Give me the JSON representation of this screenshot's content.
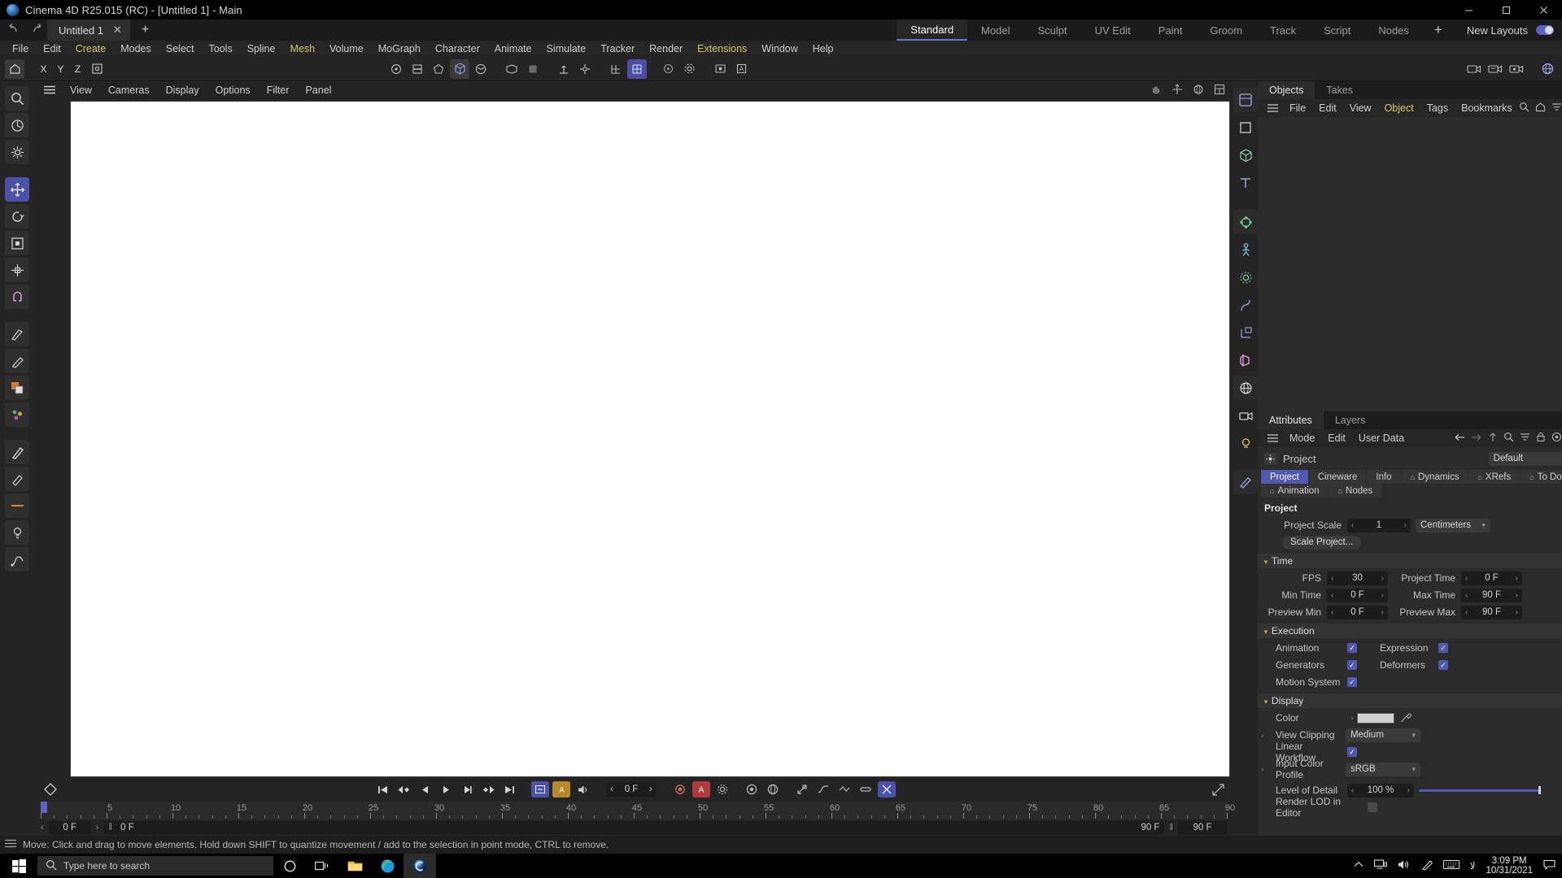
{
  "window": {
    "title": "Cinema 4D R25.015 (RC) - [Untitled 1] - Main",
    "app_icon": "cinema4d-logo-icon",
    "minimize": "–",
    "maximize": "❐",
    "close": "✕"
  },
  "tabrow": {
    "undo_icon": "undo-icon",
    "redo_icon": "redo-icon",
    "doc_tab": "Untitled 1",
    "doc_close": "✕",
    "new_tab": "+",
    "layouts": [
      {
        "label": "Standard",
        "active": true
      },
      {
        "label": "Model",
        "active": false
      },
      {
        "label": "Sculpt",
        "active": false
      },
      {
        "label": "UV Edit",
        "active": false
      },
      {
        "label": "Paint",
        "active": false
      },
      {
        "label": "Groom",
        "active": false
      },
      {
        "label": "Track",
        "active": false
      },
      {
        "label": "Script",
        "active": false
      },
      {
        "label": "Nodes",
        "active": false
      }
    ],
    "layout_add": "+",
    "new_layouts_label": "New Layouts"
  },
  "menubar": [
    {
      "label": "File",
      "highlight": false
    },
    {
      "label": "Edit",
      "highlight": false
    },
    {
      "label": "Create",
      "highlight": true
    },
    {
      "label": "Modes",
      "highlight": false
    },
    {
      "label": "Select",
      "highlight": false
    },
    {
      "label": "Tools",
      "highlight": false
    },
    {
      "label": "Spline",
      "highlight": false
    },
    {
      "label": "Mesh",
      "highlight": true
    },
    {
      "label": "Volume",
      "highlight": false
    },
    {
      "label": "MoGraph",
      "highlight": false
    },
    {
      "label": "Character",
      "highlight": false
    },
    {
      "label": "Animate",
      "highlight": false
    },
    {
      "label": "Simulate",
      "highlight": false
    },
    {
      "label": "Tracker",
      "highlight": false
    },
    {
      "label": "Render",
      "highlight": false
    },
    {
      "label": "Extensions",
      "highlight": true
    },
    {
      "label": "Window",
      "highlight": false
    },
    {
      "label": "Help",
      "highlight": false
    }
  ],
  "toolbar": {
    "left": [
      {
        "name": "home-layout-icon",
        "state": "sel"
      },
      {
        "name": "axis-x-icon",
        "state": "normal",
        "text": "X"
      },
      {
        "name": "axis-y-icon",
        "state": "normal",
        "text": "Y"
      },
      {
        "name": "axis-z-icon",
        "state": "normal",
        "text": "Z"
      },
      {
        "name": "world-object-coord-icon",
        "state": "normal"
      }
    ],
    "center": [
      {
        "name": "point-mode-icon",
        "state": "normal"
      },
      {
        "name": "edge-mode-icon",
        "state": "normal"
      },
      {
        "name": "polygon-mode-icon",
        "state": "normal"
      },
      {
        "name": "model-mode-icon",
        "state": "sel"
      },
      {
        "name": "texture-mode-icon",
        "state": "normal"
      },
      {
        "name": "workplane-icon",
        "state": "normal"
      },
      {
        "name": "viewport-solo-icon",
        "state": "normal"
      },
      {
        "name": "enable-axis-icon",
        "state": "normal"
      },
      {
        "name": "axis-lock-icon",
        "state": "normal"
      },
      {
        "name": "snap-icon",
        "state": "normal"
      },
      {
        "name": "quantize-icon",
        "state": "on"
      },
      {
        "name": "workplane-lock-icon",
        "state": "normal"
      },
      {
        "name": "render-view-icon",
        "state": "normal"
      },
      {
        "name": "render-region-icon",
        "state": "normal"
      },
      {
        "name": "render-settings-icon",
        "state": "normal"
      }
    ],
    "right": [
      {
        "name": "render-picture-viewer-icon",
        "state": "normal"
      },
      {
        "name": "render-queue-icon",
        "state": "normal"
      },
      {
        "name": "render-team-icon",
        "state": "normal"
      },
      {
        "name": "content-browser-icon",
        "state": "normal"
      }
    ]
  },
  "lefttools": [
    {
      "name": "magnify-tool-icon",
      "state": "sub"
    },
    {
      "name": "live-selection-tool-icon",
      "state": "sub"
    },
    {
      "name": "tool-settings-icon",
      "state": "sub"
    },
    {
      "name": "move-tool-icon",
      "state": "active"
    },
    {
      "name": "rotate-tool-icon",
      "state": "sub"
    },
    {
      "name": "scale-tool-icon",
      "state": "sub"
    },
    {
      "name": "transform-tool-icon",
      "state": "sub"
    },
    {
      "name": "magnet-tool-icon",
      "state": "sub"
    },
    {
      "name": "knife-tool-icon",
      "state": "sub"
    },
    {
      "name": "paint-tool-icon",
      "state": "sub"
    },
    {
      "name": "color-swatch-icon",
      "state": "sub"
    },
    {
      "name": "sculpt-tool-icon",
      "state": "sub"
    },
    {
      "name": "brush-tool-icon",
      "state": "sub"
    },
    {
      "name": "eraser-tool-icon",
      "state": "sub"
    },
    {
      "name": "light-tool-icon",
      "state": "sub"
    },
    {
      "name": "spline-pen-icon",
      "state": "sub"
    }
  ],
  "viewport": {
    "menu": [
      "View",
      "Cameras",
      "Display",
      "Options",
      "Filter",
      "Panel"
    ],
    "hamburger_icon": "hamburger-icon",
    "right_icons": [
      "pan-hand-icon",
      "move-camera-icon",
      "orbit-camera-icon",
      "maximize-view-icon"
    ],
    "background_color": "#fefefe"
  },
  "timeline": {
    "key_icon": "record-keyframe-icon",
    "transport": [
      {
        "name": "go-to-start-icon"
      },
      {
        "name": "step-back-keyframe-icon"
      },
      {
        "name": "step-back-frame-icon"
      },
      {
        "name": "play-forward-icon"
      },
      {
        "name": "step-forward-frame-icon"
      },
      {
        "name": "step-forward-keyframe-icon"
      },
      {
        "name": "go-to-end-icon"
      }
    ],
    "toggles": [
      {
        "name": "autokey-icon",
        "state": "on"
      },
      {
        "name": "keyframe-selection-icon",
        "state": "on"
      },
      {
        "name": "sound-icon",
        "state": "normal"
      }
    ],
    "current_frame": "0 F",
    "record_buttons": [
      {
        "name": "record-active-objects-icon"
      },
      {
        "name": "autokeying-icon"
      },
      {
        "name": "keyframe-settings-icon"
      },
      {
        "name": "position-key-icon"
      },
      {
        "name": "rotation-key-icon"
      },
      {
        "name": "scale-key-icon"
      },
      {
        "name": "param-key-icon"
      },
      {
        "name": "pla-key-icon"
      },
      {
        "name": "point-level-anim-icon"
      },
      {
        "name": "toggle-key-icon"
      },
      {
        "name": "auto-key-toggle-icon"
      }
    ],
    "keyframe-shape-icon": "keyframe-diamond-icon",
    "ruler": {
      "min": 0,
      "max": 90,
      "major_ticks": [
        0,
        5,
        10,
        15,
        20,
        25,
        30,
        35,
        40,
        45,
        50,
        55,
        60,
        65,
        70,
        75,
        80,
        85,
        90
      ],
      "playhead_frame": 0
    },
    "foot": {
      "prev_arrow": "‹",
      "next_arrow": "›",
      "frame_field": "0 F",
      "loop_icon": "‖",
      "loop_field": "0 F",
      "max_right": "90 F",
      "pause_icon": "‖",
      "preview_max": "90 F"
    }
  },
  "objects_panel": {
    "tabs": [
      {
        "label": "Objects",
        "active": true
      },
      {
        "label": "Takes",
        "active": false
      }
    ],
    "hamburger_icon": "hamburger-icon",
    "menu": [
      {
        "label": "File",
        "highlight": false
      },
      {
        "label": "Edit",
        "highlight": false
      },
      {
        "label": "View",
        "highlight": false
      },
      {
        "label": "Object",
        "highlight": true
      },
      {
        "label": "Tags",
        "highlight": false
      },
      {
        "label": "Bookmarks",
        "highlight": false
      }
    ],
    "icons": [
      "search-icon",
      "home-icon",
      "filter-icon",
      "open-external-icon"
    ],
    "items": []
  },
  "right_icons": [
    {
      "name": "layout-manager-icon",
      "boxed": true
    },
    {
      "name": "rectangle-primitive-icon",
      "boxed": false
    },
    {
      "name": "cube-primitive-icon",
      "boxed": false
    },
    {
      "name": "text-tool-icon",
      "boxed": false
    },
    {
      "name": "mograph-cloner-icon",
      "boxed": true
    },
    {
      "name": "character-rig-icon",
      "boxed": false
    },
    {
      "name": "simulate-particles-icon",
      "boxed": false
    },
    {
      "name": "deformer-bend-icon",
      "boxed": false
    },
    {
      "name": "scene-axis-icon",
      "boxed": false
    },
    {
      "name": "field-object-icon",
      "boxed": false
    },
    {
      "name": "environment-sky-icon",
      "boxed": false
    },
    {
      "name": "camera-object-icon",
      "boxed": false
    },
    {
      "name": "light-object-icon",
      "boxed": false
    },
    {
      "name": "material-editor-icon",
      "boxed": false
    }
  ],
  "attributes": {
    "tabs": [
      {
        "label": "Attributes",
        "active": true
      },
      {
        "label": "Layers",
        "active": false
      }
    ],
    "hamburger_icon": "hamburger-icon",
    "menu": [
      {
        "label": "Mode",
        "highlight": false
      },
      {
        "label": "Edit",
        "highlight": false
      },
      {
        "label": "User Data",
        "highlight": false
      }
    ],
    "icons": [
      "back-arrow-icon",
      "forward-arrow-icon",
      "up-arrow-icon",
      "search-icon",
      "filter-icon",
      "lock-icon",
      "target-icon",
      "open-external-icon"
    ],
    "object_icon": "project-settings-icon",
    "object_name": "Project",
    "preset_value": "Default",
    "preset_chevron": "⌄",
    "sheet_tabs": [
      {
        "label": "Project",
        "active": true,
        "lock": false
      },
      {
        "label": "Cineware",
        "active": false,
        "lock": false
      },
      {
        "label": "Info",
        "active": false,
        "lock": false
      },
      {
        "label": "Dynamics",
        "active": false,
        "lock": true
      },
      {
        "label": "XRefs",
        "active": false,
        "lock": true
      },
      {
        "label": "To Do",
        "active": false,
        "lock": true
      },
      {
        "label": "Animation",
        "active": false,
        "lock": true
      },
      {
        "label": "Nodes",
        "active": false,
        "lock": true
      }
    ],
    "section_title": "Project",
    "project_scale": {
      "label": "Project Scale",
      "value": "1",
      "unit": "Centimeters"
    },
    "scale_project_button": "Scale Project...",
    "time": {
      "section": "Time",
      "fps": {
        "label": "FPS",
        "value": "30"
      },
      "project_time": {
        "label": "Project Time",
        "value": "0 F"
      },
      "min_time": {
        "label": "Min Time",
        "value": "0 F"
      },
      "max_time": {
        "label": "Max Time",
        "value": "90 F"
      },
      "preview_min": {
        "label": "Preview Min",
        "value": "0 F"
      },
      "preview_max": {
        "label": "Preview Max",
        "value": "90 F"
      }
    },
    "execution": {
      "section": "Execution",
      "animation": {
        "label": "Animation",
        "checked": true
      },
      "expression": {
        "label": "Expression",
        "checked": true
      },
      "generators": {
        "label": "Generators",
        "checked": true
      },
      "deformers": {
        "label": "Deformers",
        "checked": true
      },
      "motion_system": {
        "label": "Motion System",
        "checked": true
      }
    },
    "display": {
      "section": "Display",
      "color": {
        "label": "Color",
        "swatch": "#d2d2d2",
        "eyedropper_icon": "eyedropper-icon"
      },
      "view_clipping": {
        "label": "View Clipping",
        "value": "Medium"
      },
      "linear_workflow": {
        "label": "Linear Workflow",
        "checked": true
      },
      "input_color_profile": {
        "label": "Input Color Profile",
        "value": "sRGB"
      },
      "level_of_detail": {
        "label": "Level of Detail",
        "value": "100 %",
        "slider_percent": 100
      },
      "render_lod_in_editor": {
        "label": "Render LOD in Editor",
        "checked": false
      }
    }
  },
  "statusbar": {
    "hamburger_icon": "hamburger-icon",
    "message": "Move: Click and drag to move elements. Hold down SHIFT to quantize movement / add to the selection in point mode, CTRL to remove."
  },
  "taskbar": {
    "start_icon": "windows-start-icon",
    "search_icon": "search-icon",
    "search_placeholder": "Type here to search",
    "apps": [
      {
        "name": "cortana-icon",
        "active": false
      },
      {
        "name": "task-view-icon",
        "active": false
      },
      {
        "name": "file-explorer-icon",
        "active": false
      },
      {
        "name": "edge-browser-icon",
        "active": false
      },
      {
        "name": "cinema4d-taskbar-icon",
        "active": true
      }
    ],
    "tray": [
      "show-hidden-icons-icon",
      "network-icon",
      "volume-icon",
      "pen-icon",
      "keyboard-icon",
      "language-icon"
    ],
    "clock_time": "3:09 PM",
    "clock_date": "10/31/2021",
    "notification_icon": "notification-icon"
  },
  "colors": {
    "accent": "#5158b0",
    "menu_highlight": "#d5c86a",
    "panel_bg": "#2b2b2b",
    "viewport_bg": "#fefefe"
  }
}
